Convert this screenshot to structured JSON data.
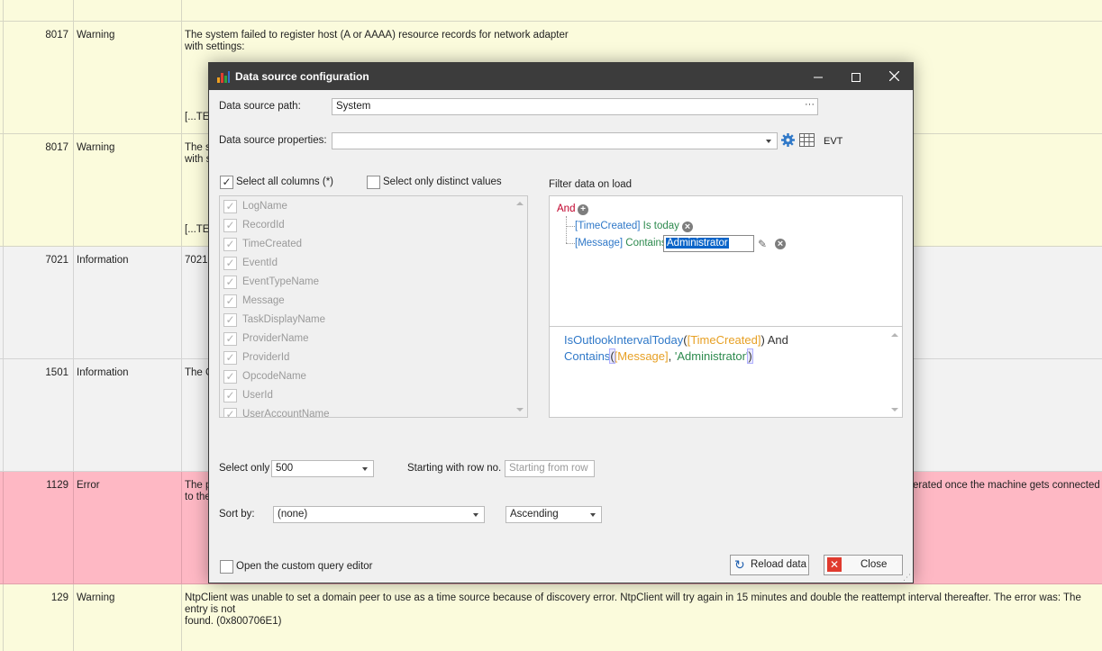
{
  "background_grid": {
    "rows": [
      {
        "id": "",
        "level": "",
        "message": "",
        "type": "warning"
      },
      {
        "id": "8017",
        "level": "Warning",
        "message": "The system failed to register host (A or AAAA) resource records for network adapter\nwith settings:\n\n\n\n\n\n[...TE",
        "type": "warning"
      },
      {
        "id": "8017",
        "level": "Warning",
        "message": "The s\nwith s\n\n\n\n\n\n[...TE",
        "type": "warning"
      },
      {
        "id": "7021",
        "level": "Information",
        "message": "7021",
        "type": "info"
      },
      {
        "id": "1501",
        "level": "Information",
        "message": "The G",
        "type": "info"
      },
      {
        "id": "1129",
        "level": "Error",
        "message": "The p\nto the",
        "message_right": "erated once the machine gets connected",
        "type": "error"
      },
      {
        "id": "129",
        "level": "Warning",
        "message": "NtpClient was unable to set a domain peer to use as a time source because of discovery error. NtpClient will try again in 15 minutes and double the reattempt interval thereafter. The error was: The entry is not\nfound. (0x800706E1)",
        "type": "warning"
      }
    ]
  },
  "dialog": {
    "title": "Data source configuration",
    "icons": {
      "app": "bar-chart-icon",
      "minimize": "minimize-icon",
      "maximize": "maximize-icon",
      "close": "close-icon"
    },
    "data_source_path_label": "Data source path:",
    "data_source_path_value": "System",
    "data_source_path_button": "···",
    "data_source_properties_label": "Data source properties:",
    "data_source_properties_value": "",
    "evt_label": "EVT",
    "select_all_columns_label": "Select all columns (*)",
    "select_all_columns_checked": true,
    "select_distinct_label": "Select only distinct values",
    "select_distinct_checked": false,
    "columns": [
      "LogName",
      "RecordId",
      "TimeCreated",
      "EventId",
      "EventTypeName",
      "Message",
      "TaskDisplayName",
      "ProviderName",
      "ProviderId",
      "OpcodeName",
      "UserId",
      "UserAccountName"
    ],
    "filter_label": "Filter data on load",
    "filter": {
      "group_operator": "And",
      "conditions": [
        {
          "field": "[TimeCreated]",
          "operator": "Is today",
          "value": ""
        },
        {
          "field": "[Message]",
          "operator": "Contains",
          "value": "Administrator"
        }
      ]
    },
    "expression": {
      "fn1": "IsOutlookIntervalToday",
      "field1": "[TimeCreated]",
      "and": "And",
      "fn2": "Contains",
      "field2": "[Message]",
      "string": "'Administrator'"
    },
    "select_only_label": "Select only",
    "select_only_value": "500",
    "starting_row_label": "Starting with row no.",
    "starting_row_placeholder": "Starting from row",
    "sort_by_label": "Sort by:",
    "sort_by_value": "(none)",
    "sort_order_value": "Ascending",
    "custom_query_label": "Open the custom query editor",
    "custom_query_checked": false,
    "reload_button": "Reload data",
    "close_button": "Close"
  },
  "colors": {
    "warning_row": "#fbfbdc",
    "info_row": "#f2f2f2",
    "error_row": "#feb8c4",
    "titlebar": "#3c3c3c",
    "field_blue": "#2f78c8",
    "operator_green": "#2d8a4e",
    "and_red": "#c0002a",
    "expr_field_orange": "#e7a024"
  }
}
